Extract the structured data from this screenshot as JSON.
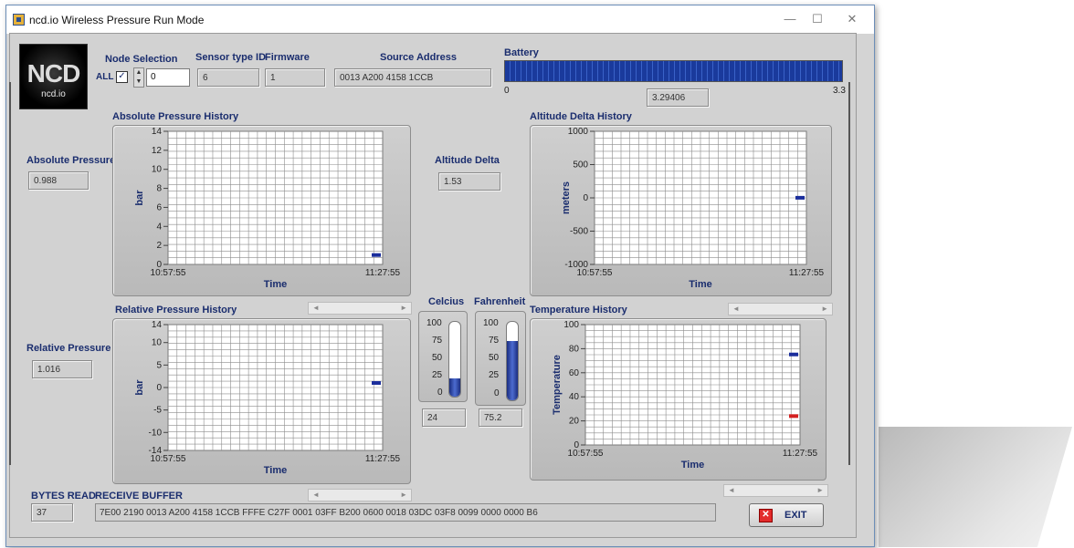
{
  "window": {
    "title": "ncd.io Wireless Pressure Run Mode"
  },
  "logo": {
    "big": "NCD",
    "small": "ncd.io"
  },
  "node": {
    "label": "Node Selection",
    "all_label": "ALL",
    "all_checked": true,
    "value": "0"
  },
  "sensor": {
    "type_label": "Sensor type ID",
    "type_value": "6",
    "firmware_label": "Firmware",
    "firmware_value": "1"
  },
  "source": {
    "label": "Source Address",
    "value": "0013 A200 4158 1CCB"
  },
  "battery": {
    "label": "Battery",
    "min": "0",
    "max": "3.3",
    "value_text": "3.29406",
    "value": 3.29406
  },
  "abs_pressure": {
    "label": "Absolute Pressure",
    "value": "0.988"
  },
  "rel_pressure": {
    "label": "Relative Pressure",
    "value": "1.016"
  },
  "altitude": {
    "label": "Altitude Delta",
    "value": "1.53"
  },
  "celcius": {
    "label": "Celcius",
    "value": "24",
    "level": 24,
    "ticks": [
      "100",
      "75",
      "50",
      "25",
      "0"
    ]
  },
  "fahrenheit": {
    "label": "Fahrenheit",
    "value": "75.2",
    "level": 75.2,
    "ticks": [
      "100",
      "75",
      "50",
      "25",
      "0"
    ]
  },
  "bytes": {
    "label": "BYTES READ",
    "value": "37"
  },
  "buffer": {
    "label": "RECEIVE BUFFER",
    "value": "7E00 2190 0013 A200 4158 1CCB FFFE C27F 0001 03FF B200 0600 0018 03DC 03F8 0099 0000 0000 B6"
  },
  "exit": {
    "label": "EXIT"
  },
  "scroll_arrows": {
    "left": "◄",
    "right": "►"
  },
  "chart_data": [
    {
      "type": "line",
      "title": "Absolute Pressure History",
      "xlabel": "Time",
      "ylabel": "bar",
      "xticks": [
        "10:57:55",
        "11:27:55"
      ],
      "yticks": [
        "14",
        "12",
        "10",
        "8",
        "6",
        "4",
        "2",
        "0"
      ],
      "ylim": [
        0,
        14
      ],
      "grid": true,
      "series": [
        {
          "values": [
            0.988
          ],
          "color": "#1b2e9c"
        }
      ]
    },
    {
      "type": "line",
      "title": "Altitude Delta History",
      "xlabel": "Time",
      "ylabel": "meters",
      "xticks": [
        "10:57:55",
        "11:27:55"
      ],
      "yticks": [
        "1000",
        "500",
        "0",
        "-500",
        "-1000"
      ],
      "ylim": [
        -1000,
        1000
      ],
      "grid": true,
      "series": [
        {
          "values": [
            1.53
          ],
          "color": "#1b2e9c"
        }
      ]
    },
    {
      "type": "line",
      "title": "Relative Pressure History",
      "xlabel": "Time",
      "ylabel": "bar",
      "xticks": [
        "10:57:55",
        "11:27:55"
      ],
      "yticks": [
        "14",
        "10",
        "5",
        "0",
        "-5",
        "-10",
        "-14"
      ],
      "ylim": [
        -14,
        14
      ],
      "grid": true,
      "series": [
        {
          "values": [
            1.016
          ],
          "color": "#1b2e9c"
        }
      ]
    },
    {
      "type": "line",
      "title": "Temperature History",
      "xlabel": "Time",
      "ylabel": "Temperature",
      "xticks": [
        "10:57:55",
        "11:27:55"
      ],
      "yticks": [
        "100",
        "80",
        "60",
        "40",
        "20",
        "0"
      ],
      "ylim": [
        0,
        100
      ],
      "grid": true,
      "series": [
        {
          "values": [
            75.2
          ],
          "color": "#1b2e9c"
        },
        {
          "values": [
            24
          ],
          "color": "#d32020"
        }
      ]
    }
  ]
}
